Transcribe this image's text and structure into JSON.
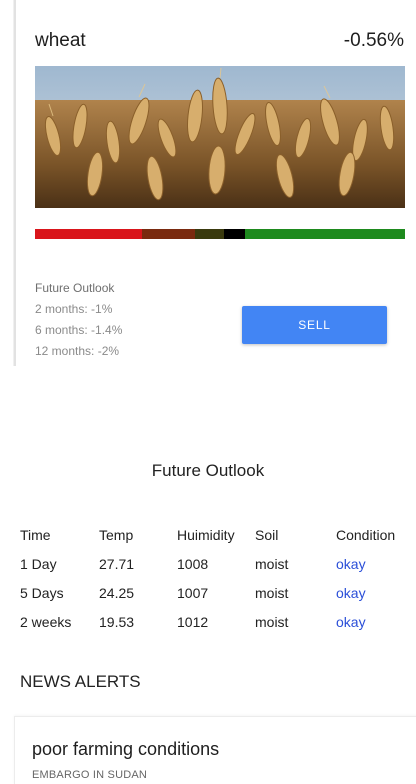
{
  "commodity": {
    "name": "wheat",
    "change": "-0.56%",
    "trend_colors": [
      "#d9151b",
      "#7a2a0f",
      "#3a3a0e",
      "#000000",
      "#1e8a1e"
    ]
  },
  "future_outlook": {
    "title": "Future Outlook",
    "lines": [
      "2 months: -1%",
      "6 months: -1.4%",
      "12 months: -2%"
    ]
  },
  "sell_button": {
    "label": "SELL",
    "color": "#4285f4"
  },
  "forecast": {
    "title": "Future Outlook",
    "headers": [
      "Time",
      "Temp",
      "Huimidity",
      "Soil",
      "Condition"
    ],
    "rows": [
      [
        "1 Day",
        "27.71",
        "1008",
        "moist",
        "okay"
      ],
      [
        "5 Days",
        "24.25",
        "1007",
        "moist",
        "okay"
      ],
      [
        "2 weeks",
        "19.53",
        "1012",
        "moist",
        "okay"
      ]
    ]
  },
  "news": {
    "heading": "NEWS ALERTS",
    "items": [
      {
        "title": "poor farming conditions",
        "subtitle": "EMBARGO IN SUDAN"
      }
    ]
  }
}
